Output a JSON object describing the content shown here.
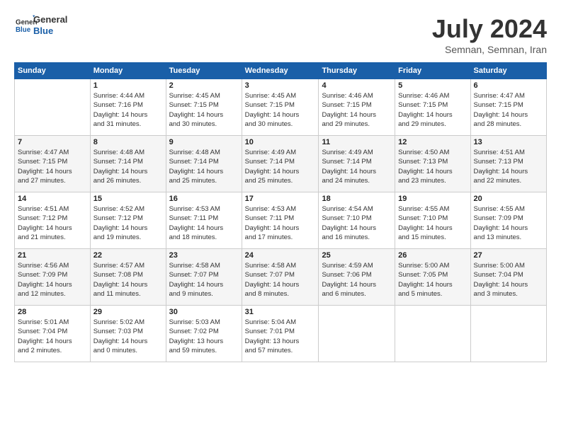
{
  "logo": {
    "line1": "General",
    "line2": "Blue"
  },
  "title": "July 2024",
  "location": "Semnan, Semnan, Iran",
  "days_header": [
    "Sunday",
    "Monday",
    "Tuesday",
    "Wednesday",
    "Thursday",
    "Friday",
    "Saturday"
  ],
  "weeks": [
    [
      {
        "day": "",
        "info": ""
      },
      {
        "day": "1",
        "info": "Sunrise: 4:44 AM\nSunset: 7:16 PM\nDaylight: 14 hours\nand 31 minutes."
      },
      {
        "day": "2",
        "info": "Sunrise: 4:45 AM\nSunset: 7:15 PM\nDaylight: 14 hours\nand 30 minutes."
      },
      {
        "day": "3",
        "info": "Sunrise: 4:45 AM\nSunset: 7:15 PM\nDaylight: 14 hours\nand 30 minutes."
      },
      {
        "day": "4",
        "info": "Sunrise: 4:46 AM\nSunset: 7:15 PM\nDaylight: 14 hours\nand 29 minutes."
      },
      {
        "day": "5",
        "info": "Sunrise: 4:46 AM\nSunset: 7:15 PM\nDaylight: 14 hours\nand 29 minutes."
      },
      {
        "day": "6",
        "info": "Sunrise: 4:47 AM\nSunset: 7:15 PM\nDaylight: 14 hours\nand 28 minutes."
      }
    ],
    [
      {
        "day": "7",
        "info": "Sunrise: 4:47 AM\nSunset: 7:15 PM\nDaylight: 14 hours\nand 27 minutes."
      },
      {
        "day": "8",
        "info": "Sunrise: 4:48 AM\nSunset: 7:14 PM\nDaylight: 14 hours\nand 26 minutes."
      },
      {
        "day": "9",
        "info": "Sunrise: 4:48 AM\nSunset: 7:14 PM\nDaylight: 14 hours\nand 25 minutes."
      },
      {
        "day": "10",
        "info": "Sunrise: 4:49 AM\nSunset: 7:14 PM\nDaylight: 14 hours\nand 25 minutes."
      },
      {
        "day": "11",
        "info": "Sunrise: 4:49 AM\nSunset: 7:14 PM\nDaylight: 14 hours\nand 24 minutes."
      },
      {
        "day": "12",
        "info": "Sunrise: 4:50 AM\nSunset: 7:13 PM\nDaylight: 14 hours\nand 23 minutes."
      },
      {
        "day": "13",
        "info": "Sunrise: 4:51 AM\nSunset: 7:13 PM\nDaylight: 14 hours\nand 22 minutes."
      }
    ],
    [
      {
        "day": "14",
        "info": "Sunrise: 4:51 AM\nSunset: 7:12 PM\nDaylight: 14 hours\nand 21 minutes."
      },
      {
        "day": "15",
        "info": "Sunrise: 4:52 AM\nSunset: 7:12 PM\nDaylight: 14 hours\nand 19 minutes."
      },
      {
        "day": "16",
        "info": "Sunrise: 4:53 AM\nSunset: 7:11 PM\nDaylight: 14 hours\nand 18 minutes."
      },
      {
        "day": "17",
        "info": "Sunrise: 4:53 AM\nSunset: 7:11 PM\nDaylight: 14 hours\nand 17 minutes."
      },
      {
        "day": "18",
        "info": "Sunrise: 4:54 AM\nSunset: 7:10 PM\nDaylight: 14 hours\nand 16 minutes."
      },
      {
        "day": "19",
        "info": "Sunrise: 4:55 AM\nSunset: 7:10 PM\nDaylight: 14 hours\nand 15 minutes."
      },
      {
        "day": "20",
        "info": "Sunrise: 4:55 AM\nSunset: 7:09 PM\nDaylight: 14 hours\nand 13 minutes."
      }
    ],
    [
      {
        "day": "21",
        "info": "Sunrise: 4:56 AM\nSunset: 7:09 PM\nDaylight: 14 hours\nand 12 minutes."
      },
      {
        "day": "22",
        "info": "Sunrise: 4:57 AM\nSunset: 7:08 PM\nDaylight: 14 hours\nand 11 minutes."
      },
      {
        "day": "23",
        "info": "Sunrise: 4:58 AM\nSunset: 7:07 PM\nDaylight: 14 hours\nand 9 minutes."
      },
      {
        "day": "24",
        "info": "Sunrise: 4:58 AM\nSunset: 7:07 PM\nDaylight: 14 hours\nand 8 minutes."
      },
      {
        "day": "25",
        "info": "Sunrise: 4:59 AM\nSunset: 7:06 PM\nDaylight: 14 hours\nand 6 minutes."
      },
      {
        "day": "26",
        "info": "Sunrise: 5:00 AM\nSunset: 7:05 PM\nDaylight: 14 hours\nand 5 minutes."
      },
      {
        "day": "27",
        "info": "Sunrise: 5:00 AM\nSunset: 7:04 PM\nDaylight: 14 hours\nand 3 minutes."
      }
    ],
    [
      {
        "day": "28",
        "info": "Sunrise: 5:01 AM\nSunset: 7:04 PM\nDaylight: 14 hours\nand 2 minutes."
      },
      {
        "day": "29",
        "info": "Sunrise: 5:02 AM\nSunset: 7:03 PM\nDaylight: 14 hours\nand 0 minutes."
      },
      {
        "day": "30",
        "info": "Sunrise: 5:03 AM\nSunset: 7:02 PM\nDaylight: 13 hours\nand 59 minutes."
      },
      {
        "day": "31",
        "info": "Sunrise: 5:04 AM\nSunset: 7:01 PM\nDaylight: 13 hours\nand 57 minutes."
      },
      {
        "day": "",
        "info": ""
      },
      {
        "day": "",
        "info": ""
      },
      {
        "day": "",
        "info": ""
      }
    ]
  ]
}
